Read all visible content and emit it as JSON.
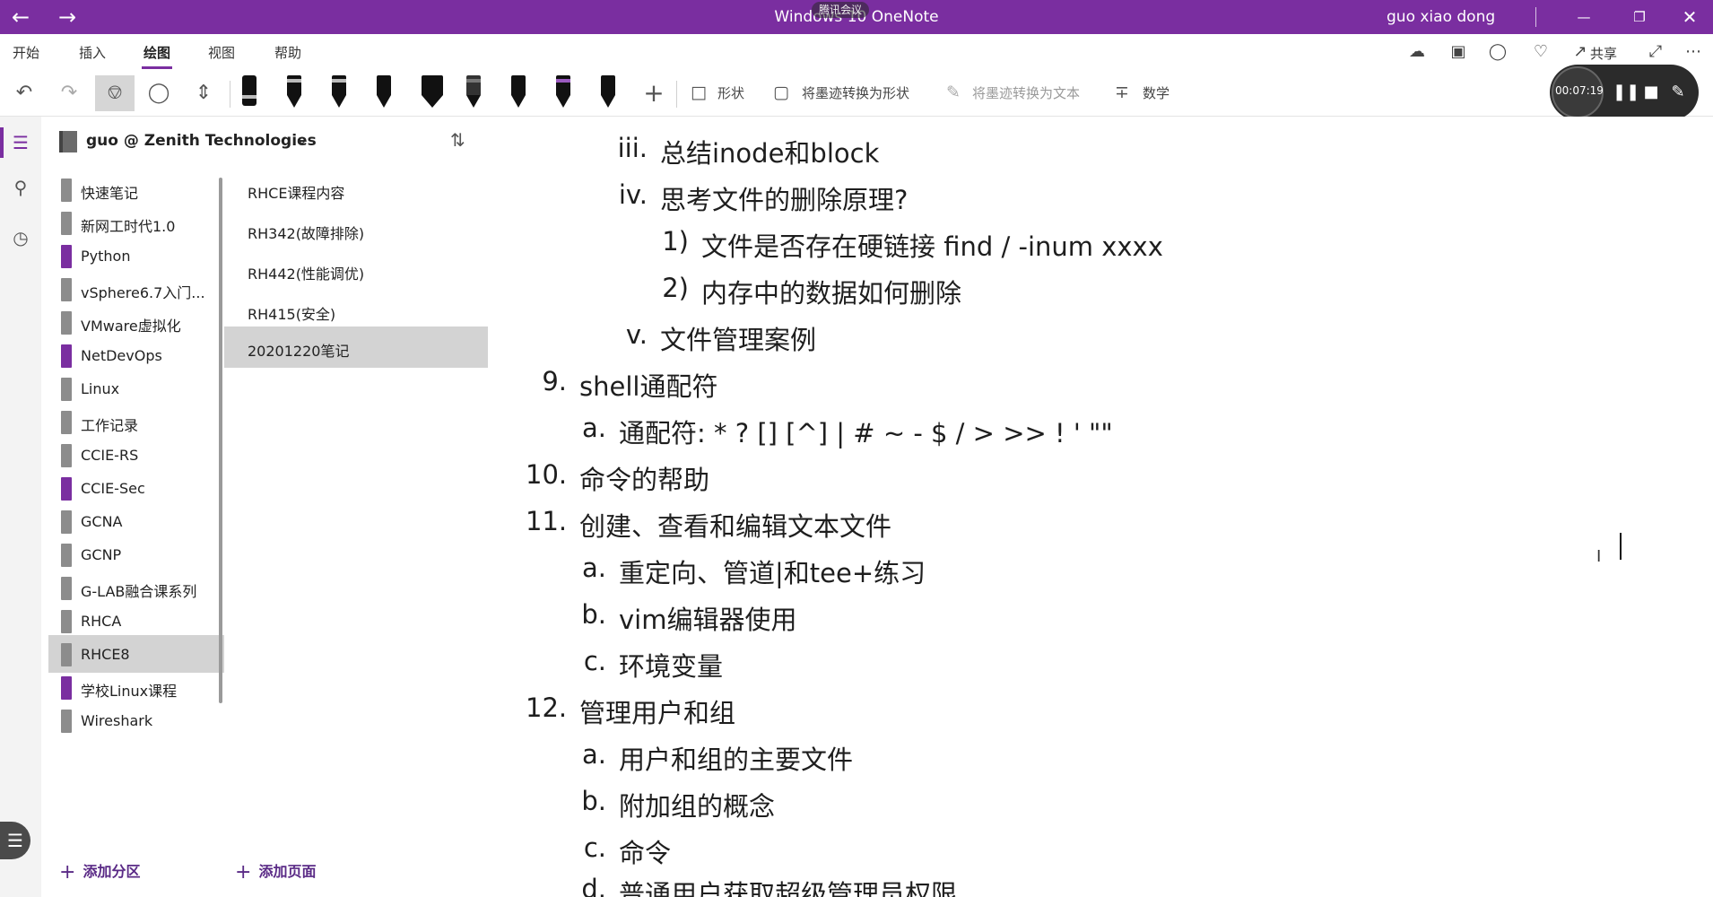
{
  "titlebar": {
    "back_icon": "arrow-left-icon",
    "forward_icon": "arrow-right-icon",
    "title": "Windows 10 OneNote",
    "meeting_badge": "腾讯会议",
    "user": "guo xiao dong",
    "accent": "#7a2ea0"
  },
  "ribbon": {
    "tabs": [
      "开始",
      "插入",
      "绘图",
      "视图",
      "帮助"
    ],
    "active_tab": "绘图",
    "share_label": "共享"
  },
  "toolbar": {
    "shapes_label": "形状",
    "ink_to_shape_label": "将墨迹转换为形状",
    "ink_to_text_label": "将墨迹转换为文本",
    "math_label": "数学"
  },
  "recorder": {
    "elapsed": "00:07:19"
  },
  "notebook": {
    "title": "guo @ Zenith Technologies"
  },
  "sections": [
    {
      "label": "快速笔记",
      "color": "gray"
    },
    {
      "label": "新网工时代1.0",
      "color": "gray"
    },
    {
      "label": "Python",
      "color": "purple"
    },
    {
      "label": "vSphere6.7入门...",
      "color": "gray"
    },
    {
      "label": "VMware虚拟化",
      "color": "gray"
    },
    {
      "label": "NetDevOps",
      "color": "purple"
    },
    {
      "label": "Linux",
      "color": "gray"
    },
    {
      "label": "工作记录",
      "color": "gray"
    },
    {
      "label": "CCIE-RS",
      "color": "gray"
    },
    {
      "label": "CCIE-Sec",
      "color": "purple"
    },
    {
      "label": "GCNA",
      "color": "gray"
    },
    {
      "label": "GCNP",
      "color": "gray"
    },
    {
      "label": "G-LAB融合课系列",
      "color": "gray"
    },
    {
      "label": "RHCA",
      "color": "gray"
    },
    {
      "label": "RHCE8",
      "color": "gray",
      "selected": true
    },
    {
      "label": "学校Linux课程",
      "color": "purple"
    },
    {
      "label": "Wireshark",
      "color": "gray"
    }
  ],
  "pages": [
    {
      "label": "RHCE课程内容"
    },
    {
      "label": "RH342(故障排除)"
    },
    {
      "label": "RH442(性能调优)"
    },
    {
      "label": "RH415(安全)"
    },
    {
      "label": "20201220笔记",
      "selected": true
    }
  ],
  "add_section_label": "添加分区",
  "add_page_label": "添加页面",
  "outline": [
    {
      "num": "iii.",
      "text": "总结inode和block"
    },
    {
      "num": "iv.",
      "text": "思考文件的删除原理?"
    },
    {
      "num": "1)",
      "text": "文件是否存在硬链接 find / -inum xxxx"
    },
    {
      "num": "2)",
      "text": "内存中的数据如何删除"
    },
    {
      "num": "v.",
      "text": "文件管理案例"
    },
    {
      "num": "9.",
      "text": "shell通配符"
    },
    {
      "num": "a.",
      "text": "通配符: * ? [] [^] | # ~ - $ / > >> ! ' \"\""
    },
    {
      "num": "10.",
      "text": "命令的帮助"
    },
    {
      "num": "11.",
      "text": "创建、查看和编辑文本文件"
    },
    {
      "num": "a.",
      "text": "重定向、管道|和tee+练习"
    },
    {
      "num": "b.",
      "text": "vim编辑器使用"
    },
    {
      "num": "c.",
      "text": "环境变量"
    },
    {
      "num": "12.",
      "text": "管理用户和组"
    },
    {
      "num": "a.",
      "text": "用户和组的主要文件"
    },
    {
      "num": "b.",
      "text": "附加组的概念"
    },
    {
      "num": "c.",
      "text": "命令"
    },
    {
      "num": "d.",
      "text": "普通用户获取超级管理员权限"
    }
  ]
}
